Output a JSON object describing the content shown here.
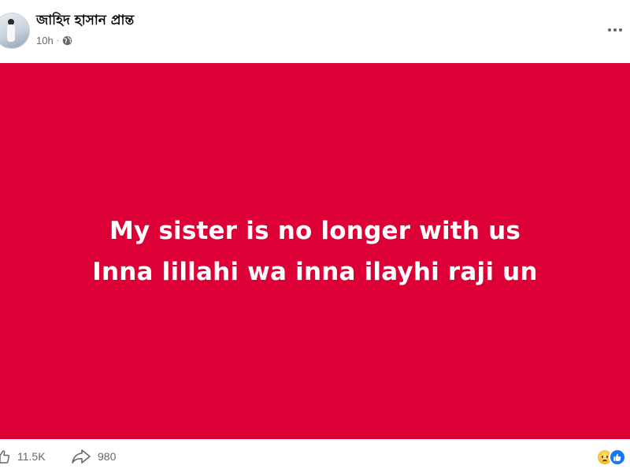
{
  "post": {
    "author": "জাহিদ হাসান প্রান্ত",
    "time": "10h",
    "separator": "·",
    "privacy_icon": "globe-icon",
    "text_line1": "My sister is no longer with us",
    "text_line2": "Inna lillahi wa inna ilayhi raji un",
    "background_color": "#dd0037"
  },
  "footer": {
    "like_count": "11.5K",
    "share_count": "980",
    "reactions": [
      "sad-reaction-icon",
      "like-reaction-icon"
    ]
  },
  "icons": {
    "more": "more-options-icon",
    "like": "like-icon",
    "share": "share-icon"
  }
}
